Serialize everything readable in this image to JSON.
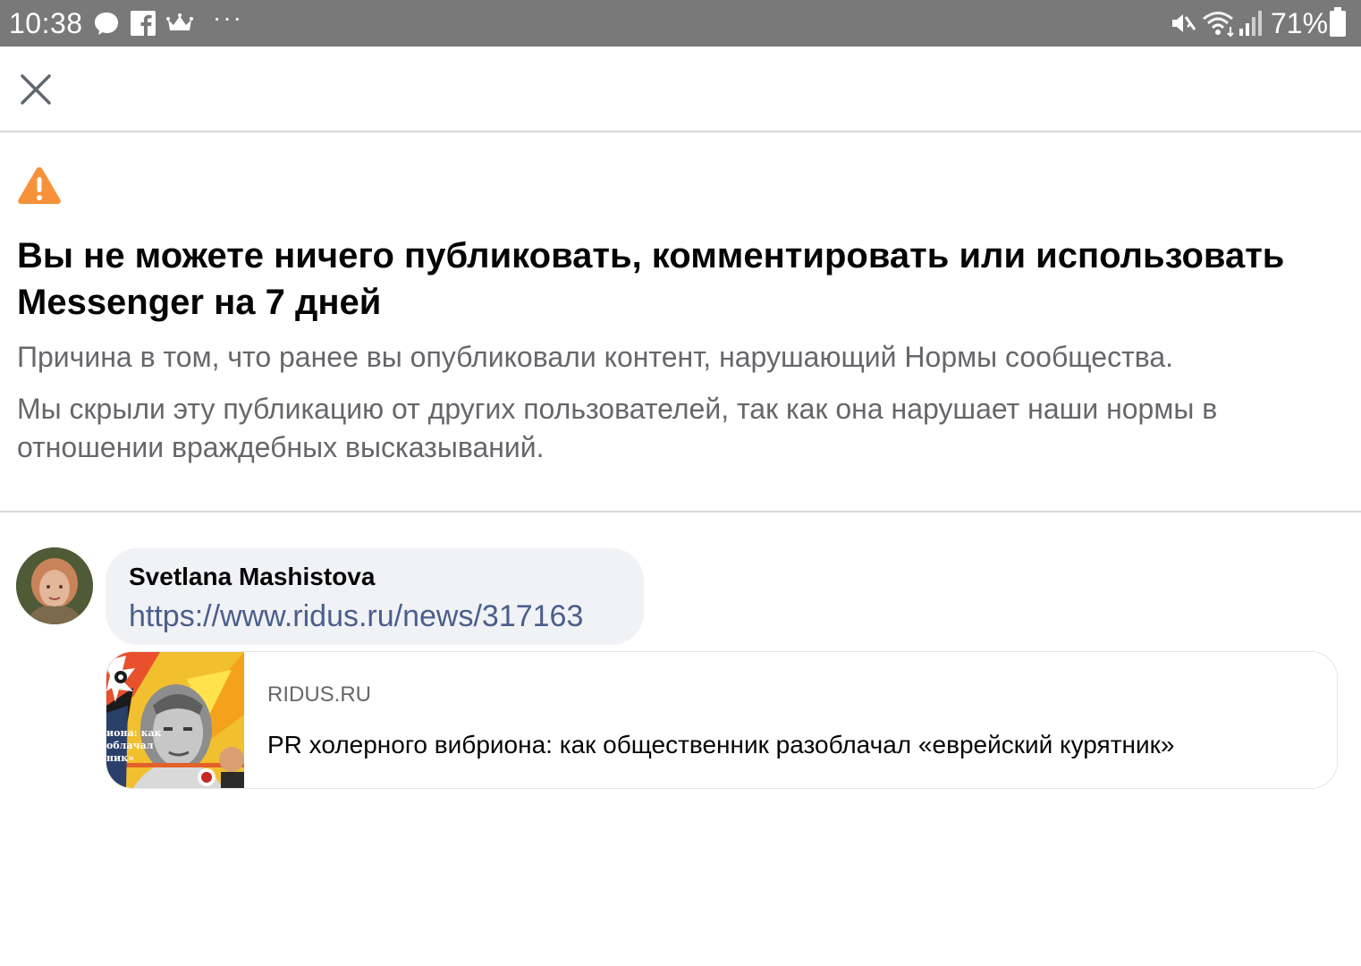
{
  "status_bar": {
    "time": "10:38",
    "battery_percent": "71%",
    "more": "···"
  },
  "header": {
    "close_label": "close"
  },
  "notice": {
    "headline": "Вы не можете ничего публиковать, комментировать или использовать Messenger на 7 дней",
    "reason": "Причина в том, что ранее вы опубликовали контент, нарушающий Нормы сообщества.",
    "hidden_note": "Мы скрыли эту публикацию от других пользователей, так как она нарушает наши нормы в отношении враждебных высказываний."
  },
  "post": {
    "author": "Svetlana Mashistova",
    "link": "https://www.ridus.ru/news/317163",
    "preview": {
      "domain": "RIDUS.RU",
      "title": "PR холерного вибриона: как общественник разоблачал «еврейский курятник»",
      "thumb_text": "иона: как\nоблачал\nник»"
    }
  },
  "colors": {
    "status_bar_bg": "#797979",
    "warning": "#f7923a",
    "link": "#4b5e8c",
    "secondary_text": "#65676b",
    "bubble_bg": "#f0f2f5"
  },
  "icons": {
    "status_left": [
      "messenger-icon",
      "facebook-icon",
      "crown-icon",
      "more-icon"
    ],
    "status_right": [
      "mute-icon",
      "wifi-icon",
      "signal-icon",
      "battery-icon"
    ],
    "warning": "warning-icon",
    "close": "close-icon"
  }
}
